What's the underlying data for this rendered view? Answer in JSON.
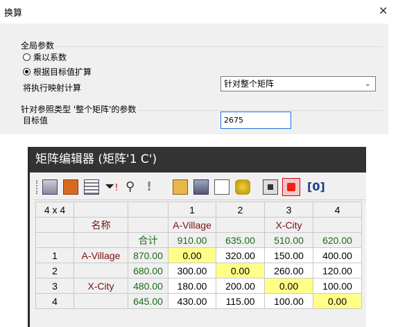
{
  "dialog": {
    "title": "换算",
    "global_group": "全局参数",
    "option_multiply": "乘以系数",
    "option_expand": "根据目标值扩算",
    "mapping_label": "将执行映射计算",
    "mapping_value": "针对整个矩阵",
    "ref_group": "针对参照类型 '整个矩阵'的参数",
    "target_label": "目标值",
    "target_value": "2675"
  },
  "editor": {
    "title": "矩阵编辑器 (矩阵'1 C')",
    "toolbar_icons": [
      "table-icon",
      "settings-icon",
      "list-icon",
      "filter-icon",
      "binoculars-icon",
      "alert-icon",
      "open-folder-icon",
      "save-copy-icon",
      "copy-icon",
      "database-icon",
      "stop-icon",
      "record-icon",
      "bracket-zero-icon"
    ],
    "corner": "4 x 4",
    "name_header": "名称",
    "total_header": "合计",
    "columns": [
      {
        "num": "1",
        "name": "A-Village",
        "total": "910.00"
      },
      {
        "num": "2",
        "name": "",
        "total": "635.00"
      },
      {
        "num": "3",
        "name": "X-City",
        "total": "510.00"
      },
      {
        "num": "4",
        "name": "",
        "total": "620.00"
      }
    ],
    "rows": [
      {
        "num": "1",
        "name": "A-Village",
        "total": "870.00",
        "values": [
          "0.00",
          "320.00",
          "150.00",
          "400.00"
        ]
      },
      {
        "num": "2",
        "name": "",
        "total": "680.00",
        "values": [
          "300.00",
          "0.00",
          "260.00",
          "120.00"
        ]
      },
      {
        "num": "3",
        "name": "X-City",
        "total": "480.00",
        "values": [
          "180.00",
          "200.00",
          "0.00",
          "100.00"
        ]
      },
      {
        "num": "4",
        "name": "",
        "total": "645.00",
        "values": [
          "430.00",
          "115.00",
          "100.00",
          "0.00"
        ]
      }
    ]
  }
}
